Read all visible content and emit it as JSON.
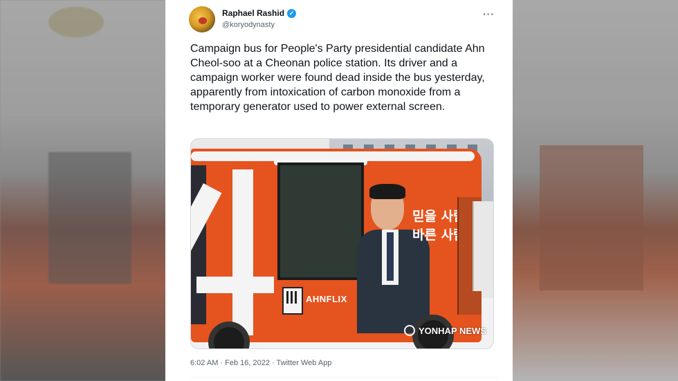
{
  "tweet": {
    "author_name": "Raphael Rashid",
    "verified": true,
    "handle": "@koryodynasty",
    "more_icon": "more-horizontal-icon",
    "text": "Campaign bus for People's Party presidential candidate Ahn Cheol-soo at a Cheonan police station. Its driver and a campaign worker were found dead inside the bus yesterday, apparently from intoxication of carbon monoxide from a temporary generator used to power external screen.",
    "timestamp": "6:02 AM · Feb 16, 2022 · Twitter Web App"
  },
  "photo": {
    "bus_number": "4",
    "slogan_line1": "믿을 사람",
    "slogan_line2": "바른 사람",
    "ahnflix": "AHNFLIX",
    "watermark": "YONHAP NEWS"
  },
  "colors": {
    "bus_orange": "#e5531f",
    "verified_blue": "#1d9bf0",
    "text_primary": "#0f1419",
    "text_secondary": "#536471"
  }
}
